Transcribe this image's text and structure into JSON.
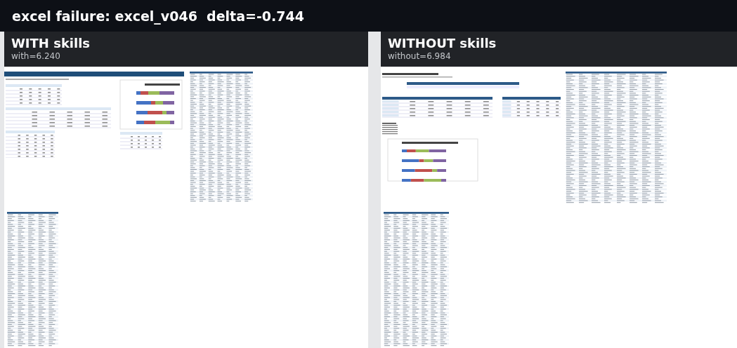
{
  "title": "excel failure: excel_v046  delta=-0.744",
  "panels": [
    {
      "heading": "WITH skills",
      "score": "with=6.240"
    },
    {
      "heading": "WITHOUT skills",
      "score": "without=6.984"
    }
  ]
}
